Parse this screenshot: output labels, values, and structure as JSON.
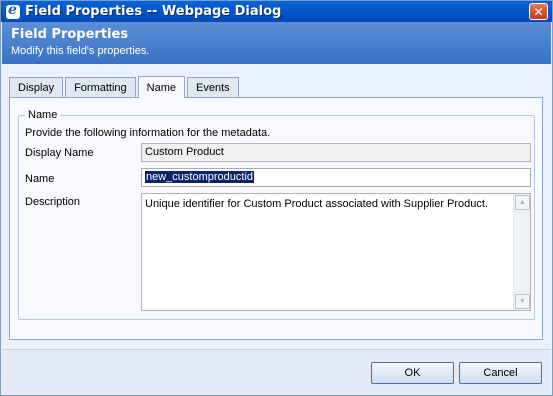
{
  "window": {
    "title": "Field Properties -- Webpage Dialog",
    "close_glyph": "✕",
    "icon": "ie-icon"
  },
  "header": {
    "title": "Field Properties",
    "subtitle": "Modify this field's properties."
  },
  "tabs": [
    {
      "label": "Display"
    },
    {
      "label": "Formatting"
    },
    {
      "label": "Name",
      "active": true
    },
    {
      "label": "Events"
    }
  ],
  "name_section": {
    "legend": "Name",
    "instruction": "Provide the following information for the metadata.",
    "display_name": {
      "label": "Display Name",
      "value": "Custom Product"
    },
    "name": {
      "label": "Name",
      "value": "new_customproductid"
    },
    "description": {
      "label": "Description",
      "value": "Unique identifier for Custom Product associated with Supplier Product."
    }
  },
  "buttons": {
    "ok": "OK",
    "cancel": "Cancel"
  },
  "colors": {
    "titlebar": "#0a63d9",
    "header": "#4a80cd",
    "selection": "#0a246a"
  }
}
